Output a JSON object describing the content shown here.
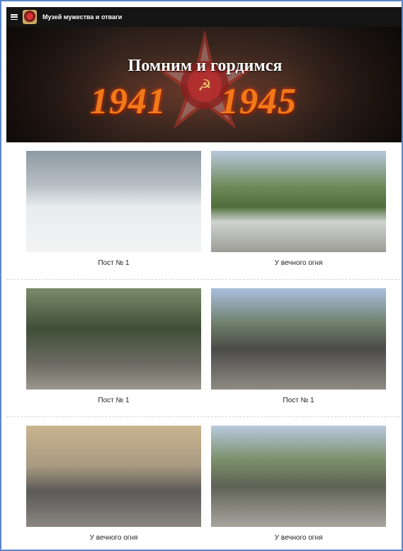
{
  "header": {
    "menu_icon": "hamburger-menu-icon",
    "logo_icon": "museum-order-logo",
    "title": "Музей мужества и отваги"
  },
  "hero": {
    "title": "Помним и гордимся",
    "year_start": "1941",
    "year_end": "1945",
    "emblem": "order-of-patriotic-war-star"
  },
  "colors": {
    "accent_border": "#5b87c9",
    "topbar": "#141414",
    "years_fire": "#f07a1a"
  },
  "gallery": {
    "items": [
      {
        "caption": "Пост № 1"
      },
      {
        "caption": "У вечного огня"
      },
      {
        "caption": "Пост № 1"
      },
      {
        "caption": "Пост № 1"
      },
      {
        "caption": "У вечного огня"
      },
      {
        "caption": "У вечного огня"
      }
    ]
  }
}
